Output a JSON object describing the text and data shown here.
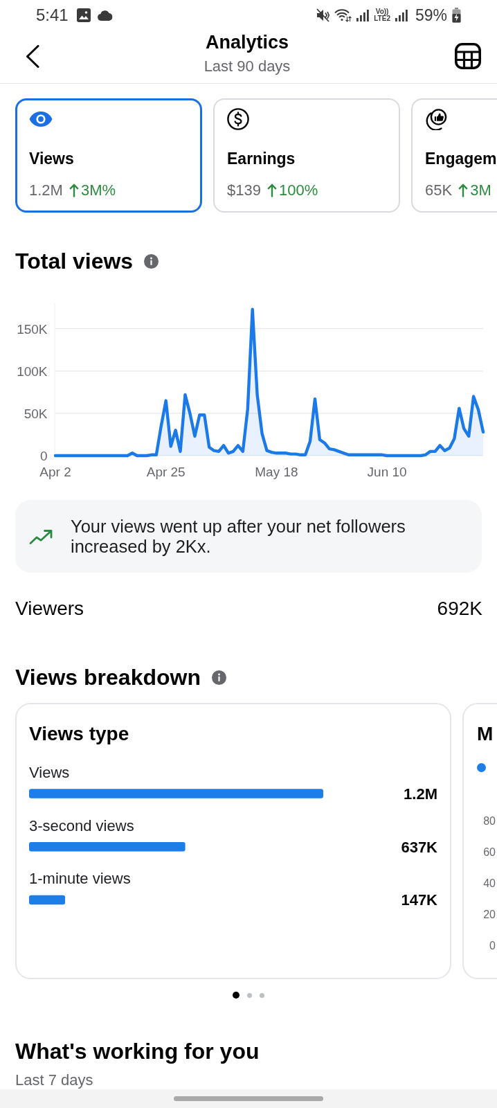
{
  "status_bar": {
    "time": "5:41",
    "network_label": {
      "top": "Vo))",
      "bottom": "LTE2"
    },
    "battery": "59%"
  },
  "header": {
    "title": "Analytics",
    "subtitle": "Last 90 days"
  },
  "metrics": [
    {
      "kind": "views",
      "title": "Views",
      "value": "1.2M",
      "change": "3M%",
      "selected": true
    },
    {
      "kind": "earnings",
      "title": "Earnings",
      "value": "$139",
      "change": "100%",
      "selected": false
    },
    {
      "kind": "engagement",
      "title": "Engagem",
      "value": "65K",
      "change": "3M",
      "selected": false
    }
  ],
  "total_views": {
    "title": "Total views",
    "chart_data": {
      "type": "area",
      "categories": [
        "Apr 2",
        null,
        null,
        null,
        null,
        null,
        null,
        null,
        null,
        null,
        null,
        null,
        null,
        null,
        null,
        null,
        null,
        null,
        null,
        null,
        null,
        null,
        null,
        "Apr 25",
        null,
        null,
        null,
        null,
        null,
        null,
        null,
        null,
        null,
        null,
        null,
        null,
        null,
        null,
        null,
        null,
        null,
        null,
        null,
        null,
        null,
        null,
        "May 18",
        null,
        null,
        null,
        null,
        null,
        null,
        null,
        null,
        null,
        null,
        null,
        null,
        null,
        null,
        null,
        null,
        null,
        null,
        null,
        null,
        null,
        null,
        "Jun 10",
        null,
        null,
        null,
        null,
        null,
        null,
        null,
        null,
        null,
        null,
        null,
        null,
        null,
        null,
        null,
        null,
        null,
        null,
        null,
        null
      ],
      "series": [
        {
          "color": "#1b7ae8",
          "values": [
            0,
            0,
            0,
            0,
            0,
            0,
            0,
            0,
            0,
            0,
            0,
            0,
            0,
            0,
            0,
            0,
            3000,
            0,
            0,
            0,
            1000,
            1000,
            35000,
            65000,
            11000,
            30000,
            5000,
            72000,
            50000,
            23000,
            48000,
            48000,
            10000,
            6000,
            5000,
            12000,
            3000,
            5000,
            12000,
            5000,
            55000,
            173000,
            72000,
            26000,
            6000,
            4000,
            3000,
            3000,
            3000,
            2000,
            2000,
            1000,
            1000,
            17000,
            67000,
            19000,
            15000,
            8000,
            7000,
            5000,
            3000,
            1000,
            1000,
            1000,
            1000,
            1000,
            1000,
            1000,
            1000,
            0,
            0,
            0,
            0,
            0,
            0,
            0,
            0,
            1000,
            5000,
            5000,
            12000,
            6000,
            9000,
            20000,
            56000,
            32000,
            23000,
            70000,
            54000,
            28000
          ]
        }
      ],
      "ylim": [
        0,
        180000
      ],
      "yticks": [
        {
          "value": 0,
          "label": "0"
        },
        {
          "value": 50000,
          "label": "50K"
        },
        {
          "value": 100000,
          "label": "100K"
        },
        {
          "value": 150000,
          "label": "150K"
        }
      ],
      "grid": true
    }
  },
  "insight": {
    "text": "Your views went up after your net followers increased by 2Kx."
  },
  "viewers": {
    "label": "Viewers",
    "value": "692K"
  },
  "breakdown": {
    "title": "Views breakdown",
    "cards": [
      {
        "kind": "bars",
        "title": "Views type",
        "chart_data": {
          "type": "bar",
          "orientation": "horizontal",
          "categories": [
            "Views",
            "3-second views",
            "1-minute views"
          ],
          "values": [
            1200000,
            637000,
            147000
          ],
          "value_labels": [
            "1.2M",
            "637K",
            "147K"
          ]
        }
      },
      {
        "kind": "chart",
        "title": "M",
        "axis_labels": [
          "80",
          "60",
          "40",
          "20",
          "0"
        ]
      }
    ],
    "pager": [
      {
        "selected": true
      },
      {
        "selected": false
      },
      {
        "selected": false
      }
    ]
  },
  "whats_working": {
    "title": "What's working for you",
    "subtitle": "Last 7 days"
  }
}
